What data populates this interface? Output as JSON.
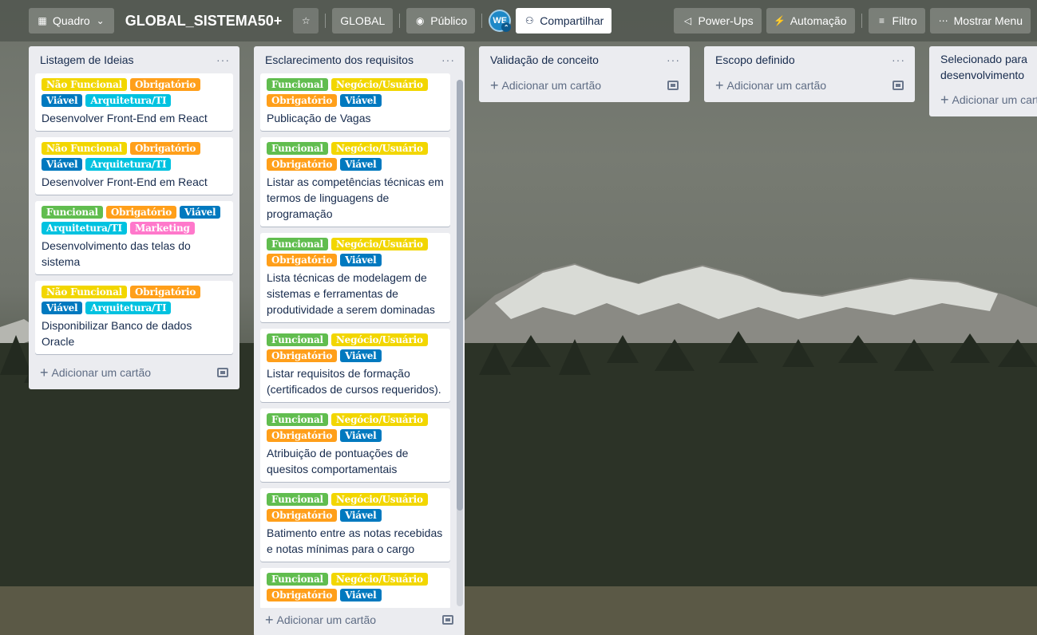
{
  "topbar": {
    "board_type_label": "Quadro",
    "board_title": "GLOBAL_SISTEMA50+",
    "workspace_label": "GLOBAL",
    "visibility_label": "Público",
    "avatar_initials": "WE",
    "share_label": "Compartilhar",
    "powerups_label": "Power-Ups",
    "automation_label": "Automação",
    "filter_label": "Filtro",
    "menu_label": "Mostrar Menu"
  },
  "label_colors": {
    "Não Funcional": "#f2d600",
    "Obrigatório": "#ff9f1a",
    "Viável": "#0079bf",
    "Arquitetura/TI": "#00c2e0",
    "Funcional": "#61bd4f",
    "Negócio/Usuário": "#f2d600",
    "Marketing": "#ff78cb"
  },
  "add_card_label": "Adicionar um cartão",
  "lists": [
    {
      "title": "Listagem de Ideias",
      "cards": [
        {
          "labels": [
            "Não Funcional",
            "Obrigatório",
            "Viável",
            "Arquitetura/TI"
          ],
          "title": "Desenvolver Front-End em React"
        },
        {
          "labels": [
            "Não Funcional",
            "Obrigatório",
            "Viável",
            "Arquitetura/TI"
          ],
          "title": "Desenvolver Front-End em React"
        },
        {
          "labels": [
            "Funcional",
            "Obrigatório",
            "Viável",
            "Arquitetura/TI",
            "Marketing"
          ],
          "title": "Desenvolvimento das telas do sistema"
        },
        {
          "labels": [
            "Não Funcional",
            "Obrigatório",
            "Viável",
            "Arquitetura/TI"
          ],
          "title": "Disponibilizar Banco de dados Oracle"
        }
      ]
    },
    {
      "title": "Esclarecimento dos requisitos",
      "cards": [
        {
          "labels": [
            "Funcional",
            "Negócio/Usuário",
            "Obrigatório",
            "Viável"
          ],
          "title": "Publicação de Vagas"
        },
        {
          "labels": [
            "Funcional",
            "Negócio/Usuário",
            "Obrigatório",
            "Viável"
          ],
          "title": "Listar as competências técnicas em termos de linguagens de programação"
        },
        {
          "labels": [
            "Funcional",
            "Negócio/Usuário",
            "Obrigatório",
            "Viável"
          ],
          "title": "Lista técnicas de modelagem de sistemas e ferramentas de produtividade a serem dominadas"
        },
        {
          "labels": [
            "Funcional",
            "Negócio/Usuário",
            "Obrigatório",
            "Viável"
          ],
          "title": "Listar requisitos de formação (certificados de cursos requeridos)."
        },
        {
          "labels": [
            "Funcional",
            "Negócio/Usuário",
            "Obrigatório",
            "Viável"
          ],
          "title": "Atribuição de pontuações de quesitos comportamentais"
        },
        {
          "labels": [
            "Funcional",
            "Negócio/Usuário",
            "Obrigatório",
            "Viável"
          ],
          "title": "Batimento entre as notas recebidas e notas mínimas para o cargo"
        },
        {
          "labels": [
            "Funcional",
            "Negócio/Usuário",
            "Obrigatório",
            "Viável"
          ],
          "title": ""
        }
      ]
    },
    {
      "title": "Validação de conceito",
      "cards": []
    },
    {
      "title": "Escopo definido",
      "cards": []
    },
    {
      "title": "Selecionado para desenvolvimento",
      "cards": []
    }
  ]
}
